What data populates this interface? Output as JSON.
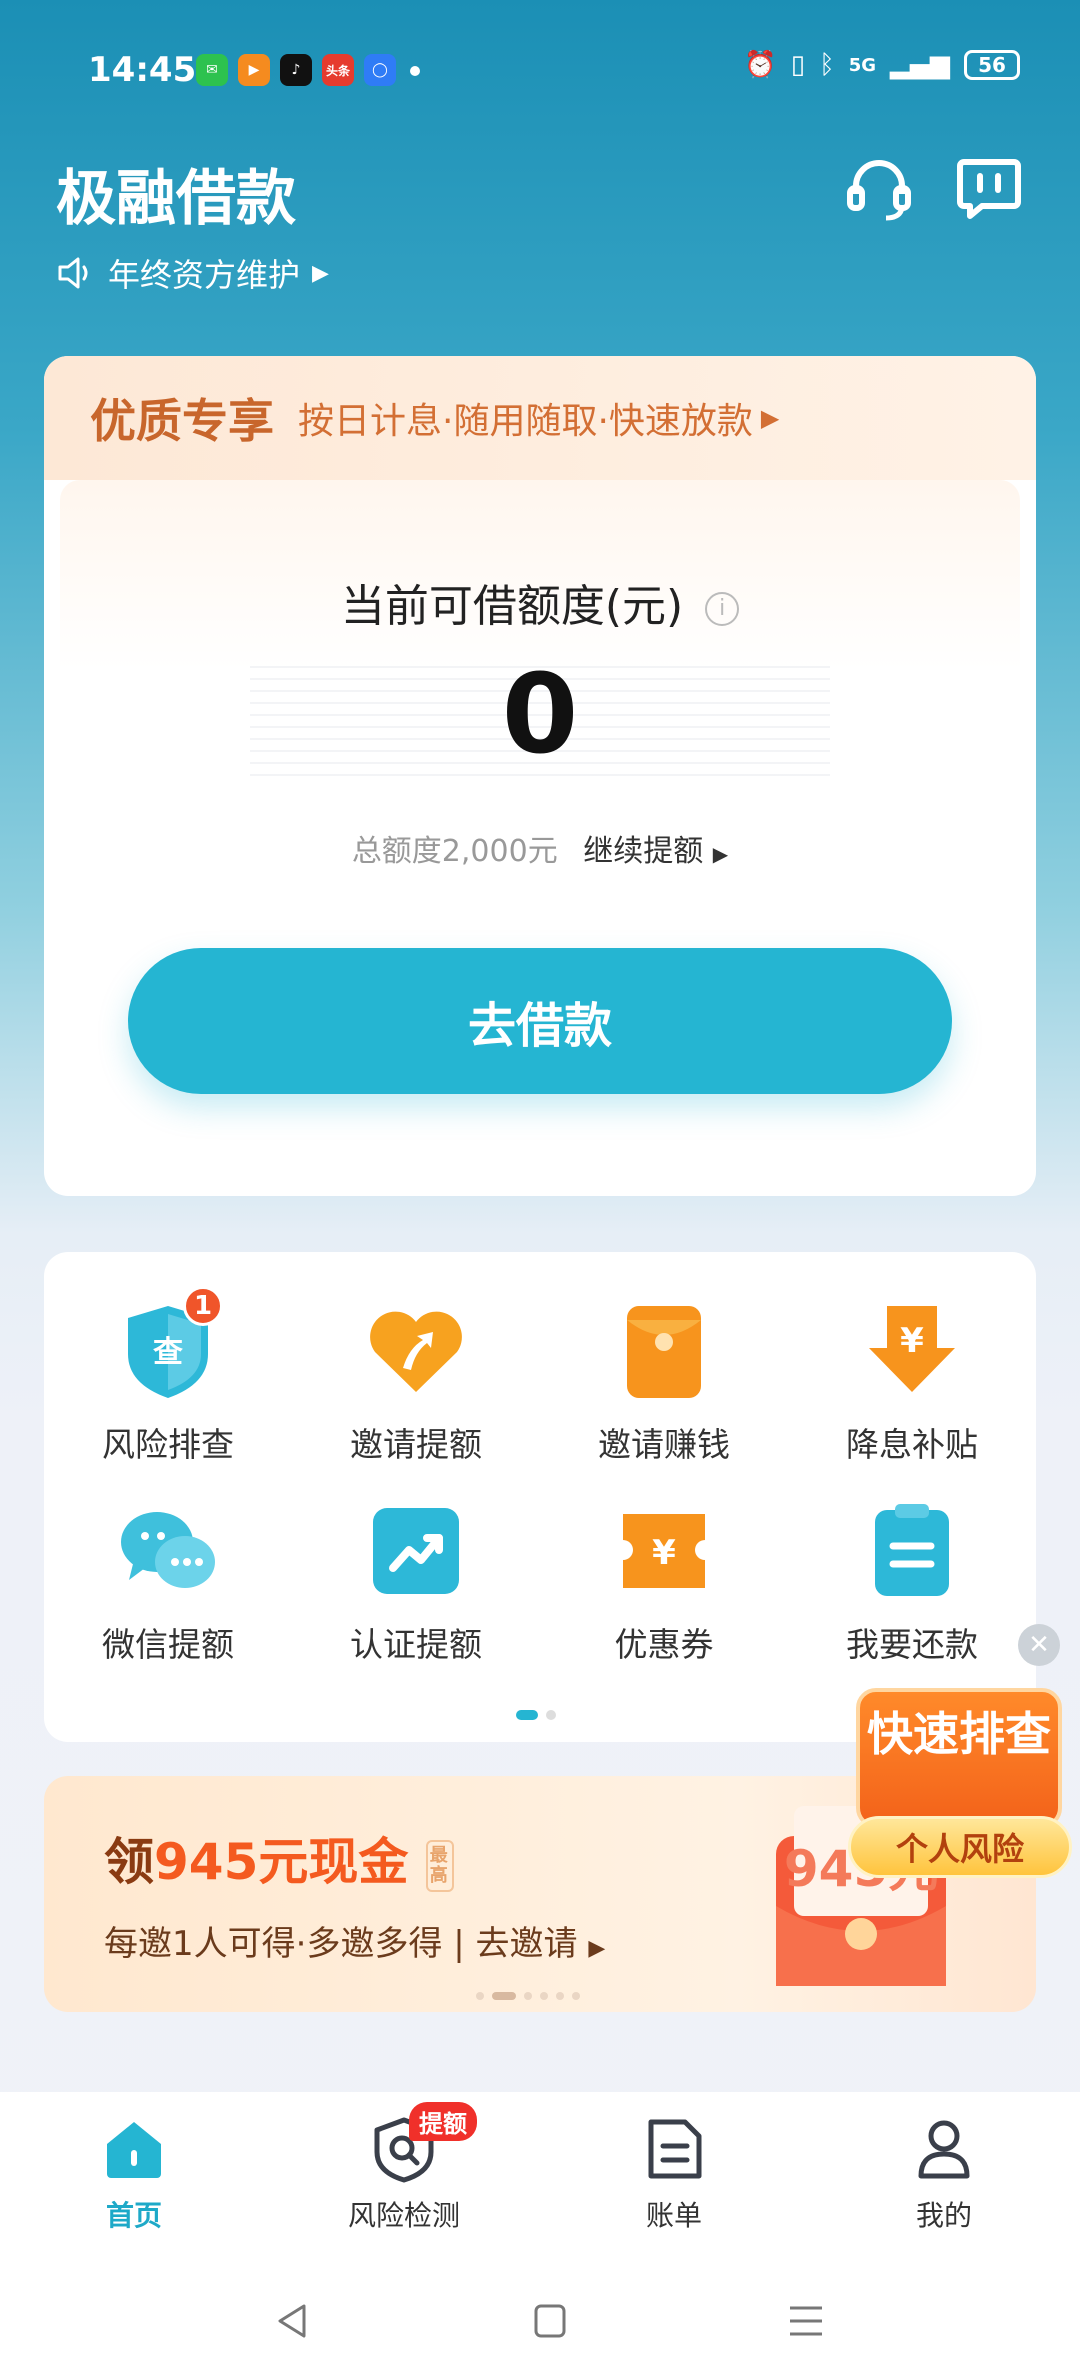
{
  "status_bar": {
    "time": "14:45",
    "apps": [
      "wechat",
      "video",
      "tiktok",
      "头条",
      "browser"
    ],
    "network": "5G",
    "battery": "56"
  },
  "header": {
    "title": "极融借款",
    "notice": "年终资方维护"
  },
  "loan_card": {
    "premium_tag": "优质专享",
    "premium_sub": "按日计息·随用随取·快速放款",
    "limit_label": "当前可借额度(元)",
    "limit_value": "0",
    "total_text": "总额度2,000元",
    "raise_link": "继续提额",
    "borrow_button": "去借款"
  },
  "functions": {
    "items": [
      {
        "label": "风险排查",
        "icon": "risk-check-icon",
        "badge": "1"
      },
      {
        "label": "邀请提额",
        "icon": "invite-raise-icon"
      },
      {
        "label": "邀请赚钱",
        "icon": "invite-earn-icon"
      },
      {
        "label": "降息补贴",
        "icon": "rate-subsidy-icon"
      },
      {
        "label": "微信提额",
        "icon": "wechat-raise-icon"
      },
      {
        "label": "认证提额",
        "icon": "verify-raise-icon"
      },
      {
        "label": "优惠券",
        "icon": "coupon-icon"
      },
      {
        "label": "我要还款",
        "icon": "repay-icon"
      }
    ]
  },
  "banner": {
    "title_prefix": "领",
    "title_amount": "945元现金",
    "tag": "最高",
    "subtitle": "每邀1人可得·多邀多得 | 去邀请",
    "envelope_amount": "945元"
  },
  "float_badge": {
    "top": "快速排查",
    "bottom": "个人风险"
  },
  "tabs": [
    {
      "label": "首页",
      "icon": "home-icon",
      "active": true
    },
    {
      "label": "风险检测",
      "icon": "risk-detect-icon",
      "badge": "提额"
    },
    {
      "label": "账单",
      "icon": "bill-icon"
    },
    {
      "label": "我的",
      "icon": "profile-icon"
    }
  ],
  "colors": {
    "accent": "#25b5d2",
    "orange": "#f45a1f",
    "premium": "#c8662c"
  }
}
